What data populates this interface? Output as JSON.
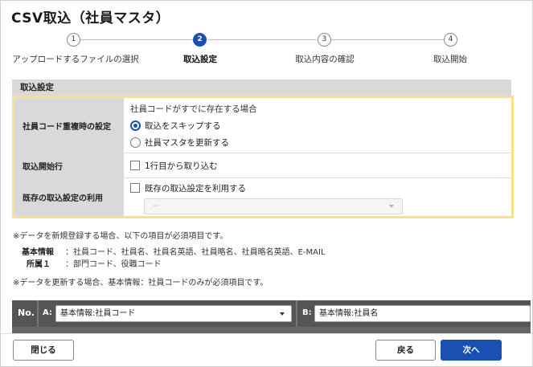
{
  "title": "CSV取込（社員マスタ）",
  "stepper": {
    "steps": [
      {
        "number": "1",
        "label": "アップロードするファイルの選択",
        "active": false
      },
      {
        "number": "2",
        "label": "取込設定",
        "active": true
      },
      {
        "number": "3",
        "label": "取込内容の確認",
        "active": false
      },
      {
        "number": "4",
        "label": "取込開始",
        "active": false
      }
    ]
  },
  "settings": {
    "section_title": "取込設定",
    "duplicate": {
      "label": "社員コード重複時の設定",
      "description": "社員コードがすでに存在する場合",
      "options": [
        {
          "label": "取込をスキップする",
          "selected": true
        },
        {
          "label": "社員マスタを更新する",
          "selected": false
        }
      ]
    },
    "start_row": {
      "label": "取込開始行",
      "checkbox_label": "1行目から取り込む",
      "checked": false
    },
    "existing": {
      "label": "既存の取込設定の利用",
      "checkbox_label": "既存の取込設定を利用する",
      "checked": false,
      "select_value": "--"
    }
  },
  "notes": {
    "new_register": "※データを新規登録する場合、以下の項目が必須項目です。",
    "basic_info_label": "基本情報",
    "basic_info_value": "：社員コード、社員名、社員名英語、社員略名、社員略名英語、E-MAIL",
    "affiliation_label": "所属１",
    "affiliation_value": "：部門コード、役職コード",
    "update": "※データを更新する場合、基本情報：社員コードのみが必須項目です。"
  },
  "mapping": {
    "no_header": "No.",
    "columns": [
      {
        "letter": "A:",
        "value": "基本情報:社員コード"
      },
      {
        "letter": "B:",
        "value": "基本情報:社員名"
      }
    ]
  },
  "footer": {
    "close_label": "閉じる",
    "back_label": "戻る",
    "next_label": "次へ"
  },
  "colors": {
    "primary": "#1a4fb4",
    "highlight_border": "#f5e38a",
    "label_bg": "#d9d9d9",
    "mapping_bar": "#555555"
  }
}
